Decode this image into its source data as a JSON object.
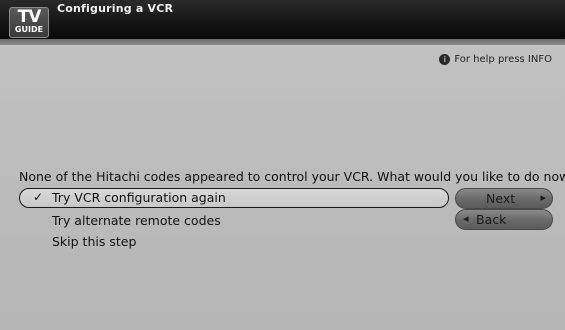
{
  "header": {
    "logo_tv": "TV",
    "logo_guide": "GUIDE",
    "title": "Configuring a VCR"
  },
  "help": {
    "icon": "info-circle-icon",
    "text": "For help press INFO"
  },
  "main": {
    "prompt": "None of the Hitachi codes appeared to control your VCR.  What would you like to do now?",
    "options": [
      {
        "label": "Try VCR configuration again",
        "selected": true,
        "marker": "✓"
      },
      {
        "label": "Try alternate remote codes",
        "selected": false
      },
      {
        "label": "Skip this step",
        "selected": false
      }
    ]
  },
  "buttons": {
    "next_label": "Next",
    "next_arrow": "▸",
    "back_label": "Back",
    "back_arrow": "◂"
  }
}
